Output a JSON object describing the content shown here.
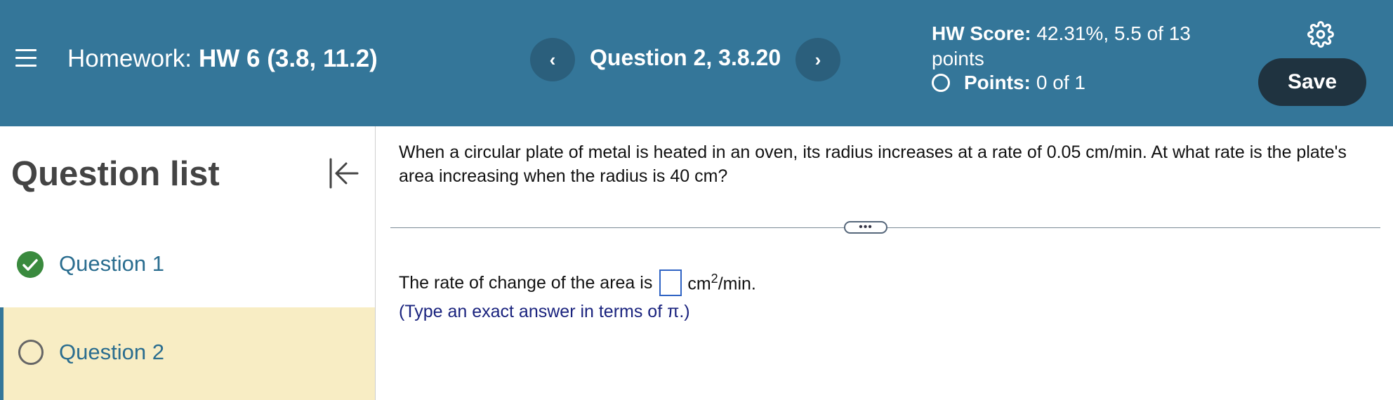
{
  "header": {
    "homework_label": "Homework:",
    "homework_name": "HW 6 (3.8, 11.2)",
    "prev_symbol": "‹",
    "next_symbol": "›",
    "question_label": "Question 2, 3.8.20",
    "hw_score_label": "HW Score:",
    "hw_score_value": "42.31%, 5.5 of 13 points",
    "points_label": "Points:",
    "points_value": "0 of 1",
    "save_label": "Save"
  },
  "sidebar": {
    "title": "Question list",
    "items": [
      {
        "label": "Question 1",
        "status": "correct"
      },
      {
        "label": "Question 2",
        "status": "unanswered",
        "active": true
      }
    ]
  },
  "main": {
    "question_text": "When a circular plate of metal is heated in an oven, its radius increases at a rate of 0.05 cm/min. At what rate is the plate's area increasing when the radius is 40 cm?",
    "expander_symbol": "•••",
    "answer_prefix": "The rate of change of the area is",
    "answer_value": "",
    "unit_base": "cm",
    "unit_exp": "2",
    "unit_suffix": "/min.",
    "hint": "(Type an exact answer in terms of π.)"
  },
  "colors": {
    "header_bg": "#347699",
    "save_bg": "#1f3340",
    "active_row_bg": "#f8edc4",
    "correct_green": "#3a8a3e",
    "link_blue": "#2a6d8f",
    "hint_blue": "#1a237e"
  }
}
